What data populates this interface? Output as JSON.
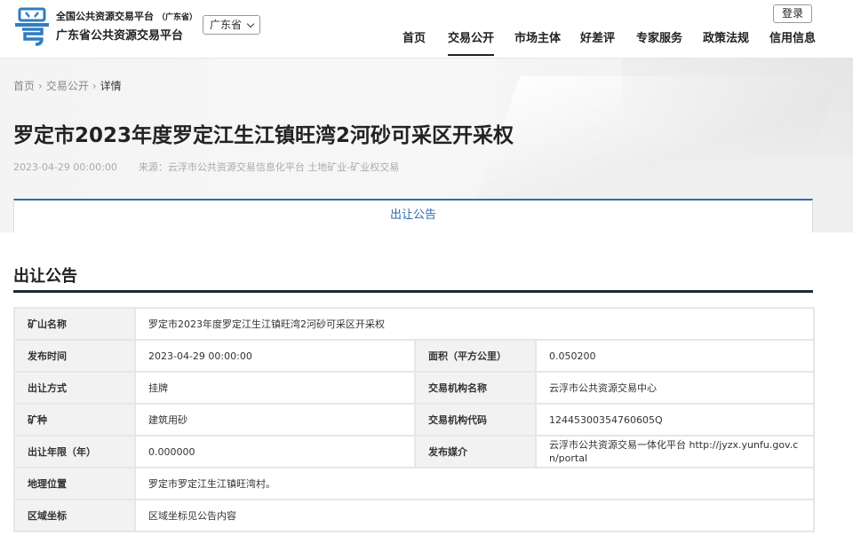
{
  "header": {
    "platform_line1": "全国公共资源交易平台",
    "platform_line1_sub": "（广东省）",
    "platform_line2": "广东省公共资源交易平台",
    "province": "广东省",
    "login": "登录",
    "nav": [
      "首页",
      "交易公开",
      "市场主体",
      "好差评",
      "专家服务",
      "政策法规",
      "信用信息"
    ],
    "active_nav": "交易公开",
    "brand_color": "#2e7dc3",
    "logo_icon": "yue-character-logo"
  },
  "breadcrumb": [
    "首页",
    "交易公开",
    "详情"
  ],
  "article": {
    "title": "罗定市2023年度罗定江生江镇旺湾2河砂可采区开采权",
    "date": "2023-04-29 00:00:00",
    "source": "来源：云浮市公共资源交易信息化平台  土地矿业-矿业权交易"
  },
  "tab": {
    "label": "出让公告",
    "accent": "#2e6ab0"
  },
  "section": {
    "title": "出让公告"
  },
  "table": {
    "mine_name_label": "矿山名称",
    "mine_name": "罗定市2023年度罗定江生江镇旺湾2河砂可采区开采权",
    "publish_time_label": "发布时间",
    "publish_time": "2023-04-29 00:00:00",
    "area_label": "面积（平方公里）",
    "area": "0.050200",
    "transfer_method_label": "出让方式",
    "transfer_method": "挂牌",
    "agency_name_label": "交易机构名称",
    "agency_name": "云浮市公共资源交易中心",
    "mineral_label": "矿种",
    "mineral": "建筑用砂",
    "agency_code_label": "交易机构代码",
    "agency_code": "12445300354760605Q",
    "term_label": "出让年限（年）",
    "term": "0.000000",
    "media_label": "发布媒介",
    "media": "云浮市公共资源交易一体化平台 http://jyzx.yunfu.gov.cn/portal",
    "location_label": "地理位置",
    "location": "罗定市罗定江生江镇旺湾村。",
    "coords_label": "区域坐标",
    "coords": "区域坐标见公告内容"
  }
}
